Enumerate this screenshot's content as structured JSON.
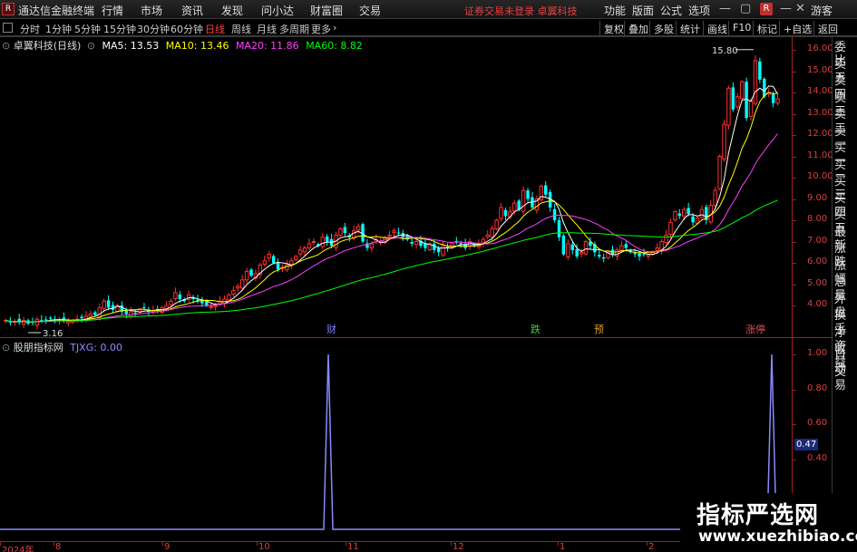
{
  "menubar": {
    "title": "通达信金融终端",
    "logo": "R",
    "items": [
      "行情",
      "市场",
      "资讯",
      "发现",
      "问小达",
      "财富圈",
      "交易"
    ],
    "notice": "证券交易未登录   卓翼科技",
    "right_items": [
      "功能",
      "版面",
      "公式",
      "选项"
    ],
    "badge": "R",
    "guest": "游客"
  },
  "toolbar": {
    "periods": [
      "分时",
      "1分钟",
      "5分钟",
      "15分钟",
      "30分钟",
      "60分钟",
      "日线",
      "周线",
      "月线",
      "多周期",
      "更多"
    ],
    "active_period": "日线",
    "buttons": [
      "复权",
      "叠加",
      "多股",
      "统计",
      "画线",
      "F10",
      "标记",
      "+自选",
      "返回"
    ]
  },
  "main_chart": {
    "stock_name": "卓翼科技(日线)",
    "ma5": "MA5: 13.53",
    "ma10": "MA10: 13.46",
    "ma20": "MA20: 11.86",
    "ma60": "MA60: 8.82",
    "high_label": "15.80",
    "low_label": "3.16",
    "price_ticks": [
      "16.00",
      "15.00",
      "14.00",
      "13.00",
      "12.00",
      "11.00",
      "10.00",
      "9.00",
      "8.00",
      "7.00",
      "6.00",
      "5.00",
      "4.00"
    ],
    "markers": [
      {
        "text": "财",
        "color": "#7b7bff"
      },
      {
        "text": "跌",
        "color": "#40d040"
      },
      {
        "text": "预",
        "color": "#e0a020"
      },
      {
        "text": "涨停",
        "color": "#e05050"
      }
    ]
  },
  "indicator": {
    "name": "股朋指标网",
    "value": "TJXG: 0.00",
    "ticks": [
      "1.00",
      "0.80",
      "0.60",
      "0.40"
    ],
    "cursor_value": "0.47"
  },
  "right_panel": [
    "委比",
    "卖五",
    "卖四",
    "卖三",
    "卖二",
    "卖一",
    "买一",
    "买二",
    "买三",
    "买四",
    "买五",
    "最新",
    "涨跌",
    "涨幅",
    "总量",
    "外盘",
    "换手",
    "净资",
    "收益",
    "自动",
    "交易"
  ],
  "dates": [
    "2024年",
    "8",
    "9",
    "10",
    "11",
    "12",
    "1",
    "2"
  ],
  "watermark": {
    "title": "指标严选网",
    "url": "www.xuezhibiao.com"
  },
  "colors": {
    "up": "#ff3030",
    "down": "#00ffff",
    "ma5": "#ffffff",
    "ma10": "#ffff00",
    "ma20": "#ff40ff",
    "ma60": "#00ff00",
    "indicator": "#8a8aff"
  },
  "chart_data": {
    "type": "line",
    "ylim": [
      3.5,
      16.5
    ],
    "candles_close": [
      3.3,
      3.2,
      3.25,
      3.2,
      3.3,
      3.15,
      3.2,
      3.35,
      3.3,
      3.3,
      3.4,
      3.3,
      3.35,
      3.3,
      3.25,
      3.3,
      3.35,
      3.4,
      3.5,
      3.6,
      3.55,
      3.9,
      4.2,
      3.9,
      3.8,
      4.0,
      3.7,
      3.6,
      3.7,
      3.65,
      3.8,
      3.9,
      3.7,
      3.75,
      3.8,
      3.9,
      4.0,
      4.2,
      4.6,
      4.3,
      4.2,
      4.5,
      4.3,
      4.2,
      4.1,
      4.0,
      3.95,
      4.0,
      4.2,
      4.3,
      4.5,
      4.7,
      4.9,
      5.2,
      5.6,
      5.4,
      5.5,
      5.9,
      6.1,
      6.4,
      6.0,
      5.7,
      5.8,
      5.9,
      6.1,
      6.3,
      6.6,
      6.7,
      6.9,
      7.0,
      6.8,
      7.2,
      7.0,
      6.8,
      7.3,
      7.6,
      7.4,
      7.2,
      7.5,
      7.7,
      7.0,
      6.7,
      6.9,
      7.1,
      7.0,
      7.2,
      7.3,
      7.5,
      7.4,
      7.2,
      7.1,
      6.9,
      7.0,
      6.8,
      6.7,
      6.9,
      6.6,
      6.5,
      6.8,
      6.7,
      6.9,
      7.0,
      6.9,
      6.7,
      7.0,
      6.8,
      6.9,
      7.1,
      7.3,
      7.6,
      8.0,
      8.6,
      8.2,
      8.4,
      8.8,
      8.5,
      9.4,
      9.0,
      8.6,
      9.0,
      9.6,
      9.2,
      8.6,
      8.0,
      7.2,
      6.4,
      6.9,
      6.6,
      6.3,
      6.5,
      7.0,
      6.8,
      6.5,
      6.3,
      6.2,
      6.5,
      6.4,
      6.6,
      6.8,
      6.7,
      6.5,
      6.4,
      6.3,
      6.4,
      6.4,
      6.5,
      6.7,
      7.0,
      7.3,
      7.9,
      8.4,
      8.2,
      8.5,
      8.3,
      7.9,
      8.1,
      8.5,
      8.0,
      8.7,
      9.4,
      11.0,
      12.5,
      14.2,
      13.2,
      13.8,
      14.5,
      12.8,
      13.6,
      15.5,
      14.6,
      13.8,
      14.0,
      13.5,
      13.7
    ],
    "indicator_signal_indices": [
      60,
      171
    ],
    "ma_last": {
      "MA5": 13.53,
      "MA10": 13.46,
      "MA20": 11.86,
      "MA60": 8.82
    }
  }
}
